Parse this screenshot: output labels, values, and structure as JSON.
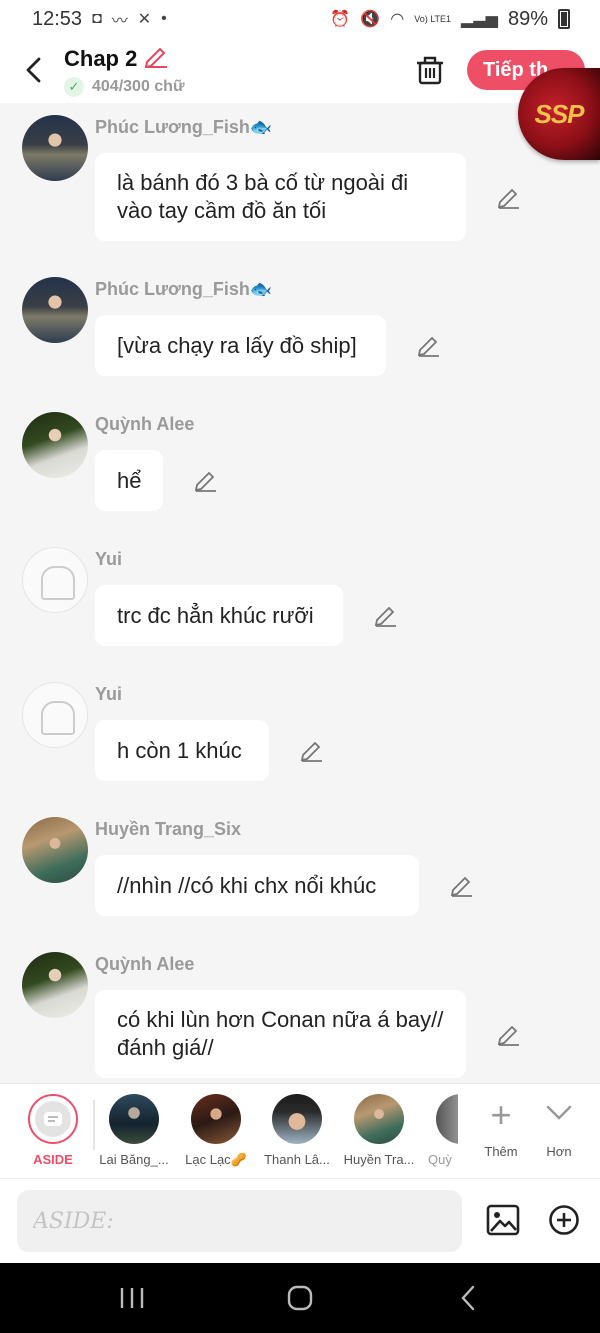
{
  "status_bar": {
    "time": "12:53",
    "battery": "89%",
    "net": "Vo) LTE1"
  },
  "header": {
    "title": "Chap 2",
    "word_count": "404/300 chữ",
    "next_button": "Tiếp th",
    "sticker_text": "SSP"
  },
  "messages": [
    {
      "name": "Phúc Lương_Fish🐟",
      "text": "là bánh đó 3 bà cố từ ngoài đi vào tay cầm đồ ăn tối"
    },
    {
      "name": "Phúc Lương_Fish🐟",
      "text": "[vừa chạy ra lấy đồ ship]"
    },
    {
      "name": "Quỳnh Alee",
      "text": "hể"
    },
    {
      "name": "Yui",
      "text": "trc đc hẳn khúc rưỡi"
    },
    {
      "name": "Yui",
      "text": "h còn 1 khúc"
    },
    {
      "name": "Huyền Trang_Six",
      "text": "//nhìn //có khi chx nổi khúc"
    },
    {
      "name": "Quỳnh Alee",
      "text": "có khi lùn hơn Conan nữa á bay//đánh giá//"
    }
  ],
  "tray": {
    "aside_label": "ASIDE",
    "characters": [
      "Lai Băng_...",
      "Lạc Lạc🥜",
      "Thanh Lâ...",
      "Huyền Tra...",
      "Quỳ"
    ],
    "more_label": "Thêm",
    "less_label": "Hơn"
  },
  "input": {
    "placeholder": "ASIDE:"
  },
  "colors": {
    "accent": "#ef4e67",
    "background": "#f5f5f5",
    "bubble": "#ffffff"
  }
}
